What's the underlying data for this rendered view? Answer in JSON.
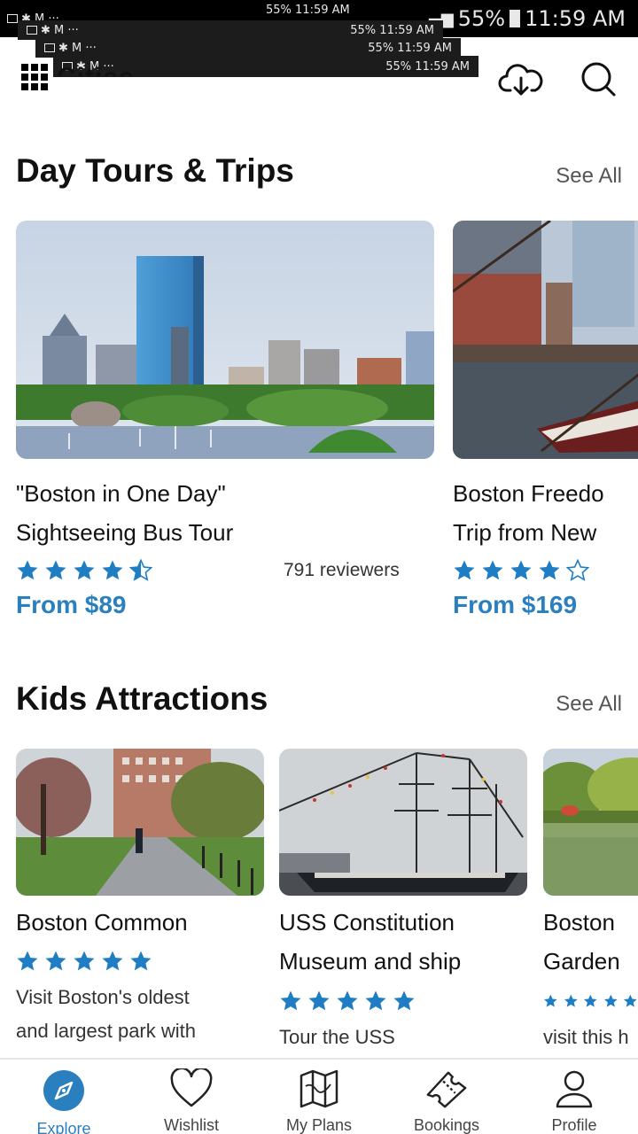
{
  "status_bar": {
    "battery": "55%",
    "time": "11:59 AM",
    "notif_icons": "✱ M ···",
    "small_battery_time": "55% 11:59 AM"
  },
  "header": {
    "title": "Cities",
    "icons": [
      "grid-logo-icon",
      "cloud-download-icon",
      "search-icon"
    ]
  },
  "day_tours": {
    "title": "Day Tours & Trips",
    "see_all": "See All",
    "cards": [
      {
        "title_line1": "\"Boston in One Day\"",
        "title_line2": "Sightseeing Bus Tour",
        "rating": 4.5,
        "reviews": "791 reviewers",
        "price": "From $89"
      },
      {
        "title_line1": "Boston Freedo",
        "title_line2": "Trip from New",
        "rating": 4,
        "price": "From $169"
      }
    ]
  },
  "kids_attractions": {
    "title": "Kids Attractions",
    "see_all": "See All",
    "cards": [
      {
        "title_line1": "Boston Common",
        "rating": 5,
        "desc_line1": "Visit Boston's oldest",
        "desc_line2": "and largest park with"
      },
      {
        "title_line1": "USS Constitution",
        "title_line2": "Museum and ship",
        "rating": 5,
        "desc_line1": "Tour the USS"
      },
      {
        "title_line1": "Boston",
        "title_line2": "Garden",
        "rating": 5,
        "desc_line1": "visit this h"
      }
    ]
  },
  "bottom_nav": [
    {
      "label": "Explore",
      "icon": "compass-icon",
      "active": true
    },
    {
      "label": "Wishlist",
      "icon": "heart-icon"
    },
    {
      "label": "My Plans",
      "icon": "map-icon"
    },
    {
      "label": "Bookings",
      "icon": "ticket-icon"
    },
    {
      "label": "Profile",
      "icon": "person-icon"
    }
  ],
  "colors": {
    "accent": "#2a7fbf",
    "star": "#1f7dc4"
  }
}
